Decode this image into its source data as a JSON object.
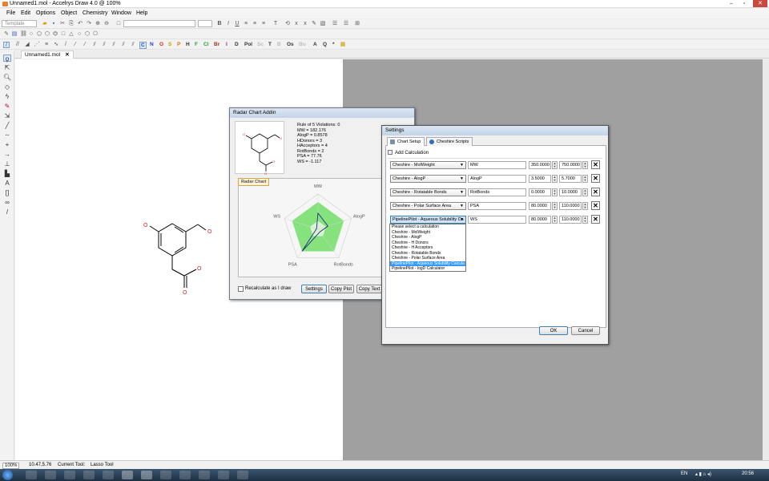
{
  "window": {
    "title": "Unnamed1.mol - Accelrys Draw 4.0 @ 100%",
    "controls": [
      "–",
      "▫",
      "✕"
    ]
  },
  "menu": [
    "File",
    "Edit",
    "Options",
    "Object",
    "Chemistry",
    "Window",
    "Help"
  ],
  "toolbar": {
    "template_combo": "Template",
    "elements": [
      {
        "label": "C",
        "color": "#1f3fd6"
      },
      {
        "label": "N",
        "color": "#1f3fd6"
      },
      {
        "label": "O",
        "color": "#e02020"
      },
      {
        "label": "S",
        "color": "#c8a000"
      },
      {
        "label": "P",
        "color": "#e07000"
      },
      {
        "label": "H",
        "color": "#333333"
      },
      {
        "label": "F",
        "color": "#2a9d2a"
      },
      {
        "label": "Cl",
        "color": "#2a9d2a"
      },
      {
        "label": "Br",
        "color": "#a0301c"
      },
      {
        "label": "I",
        "color": "#7a2ca0"
      },
      {
        "label": "D",
        "color": "#333333"
      },
      {
        "label": "Pol",
        "color": "#333333"
      },
      {
        "label": "Sc",
        "color": "#bbbbbb"
      },
      {
        "label": "T",
        "color": "#333333"
      },
      {
        "label": "B",
        "color": "#bbbbbb"
      },
      {
        "label": "Os",
        "color": "#333333"
      },
      {
        "label": "Bu",
        "color": "#bbbbbb"
      },
      {
        "label": "A",
        "color": "#333333"
      },
      {
        "label": "Q",
        "color": "#333333"
      },
      {
        "label": "*",
        "color": "#333333"
      }
    ]
  },
  "document_tab": {
    "label": "Unnamed1.mol",
    "close": "✕"
  },
  "radar_dialog": {
    "title": "Radar Chart Addin",
    "properties": [
      "Rule of 5 Violations: 0",
      "MW = 182.176",
      "AlogP = 0.8578",
      "HDonors = 3",
      "HAcceptors = 4",
      "RotBonds = 2",
      "PSA = 77.76",
      "WS = -1.117"
    ],
    "chart_tab": "Radar Chart",
    "recalc_label": "Recalculate as I draw",
    "buttons": {
      "settings": "Settings",
      "copy_plot": "Copy Plot",
      "copy_text": "Copy Text"
    }
  },
  "chart_data": {
    "type": "radar",
    "axes": [
      "MW",
      "AlogP",
      "RotBonds",
      "PSA",
      "WS"
    ],
    "band_color": "#86e27d",
    "band_inner_color": "#d9f5d2",
    "series_color": "#1a2f7a"
  },
  "settings_dialog": {
    "title": "Settings",
    "tabs": [
      "Chart Setup",
      "Cheshire Scripts"
    ],
    "add_calc": "Add Calculation",
    "rows": [
      {
        "calc": "Cheshire - MolWeight",
        "abbr": "MW",
        "min": "350.0000",
        "max": "750.0000"
      },
      {
        "calc": "Cheshire - AlogP",
        "abbr": "AlogP",
        "min": "3.5000",
        "max": "5.7000"
      },
      {
        "calc": "Cheshire - Rotatable Bonds",
        "abbr": "RotBonds",
        "min": "0.0000",
        "max": "10.0000"
      },
      {
        "calc": "Cheshire - Polar Surface Area",
        "abbr": "PSA",
        "min": "80.0000",
        "max": "110.0000"
      },
      {
        "calc": "PipelinePilot - Aqueous Solubility Ca",
        "abbr": "WS",
        "min": "80.0000",
        "max": "110.0000"
      }
    ],
    "dropdown_options": [
      "Please select a calculation",
      "Cheshire - MolWeight",
      "Cheshire - AlogP",
      "Cheshire - H Donors",
      "Cheshire - H Acceptors",
      "Cheshire - Rotatable Bonds",
      "Cheshire - Polar Surface Area",
      "PipelinePilot - Aqueous Solubility Calcula",
      "PipelinePilot - logD Calculator"
    ],
    "dropdown_selected_index": 7,
    "ok": "OK",
    "cancel": "Cancel"
  },
  "statusbar": {
    "zoom": "100%",
    "coords": "10.47,5.76",
    "current_tool_label": "Current Tool:",
    "current_tool": "Lasso Tool"
  },
  "taskbar": {
    "lang": "EN",
    "time": "20:56"
  }
}
